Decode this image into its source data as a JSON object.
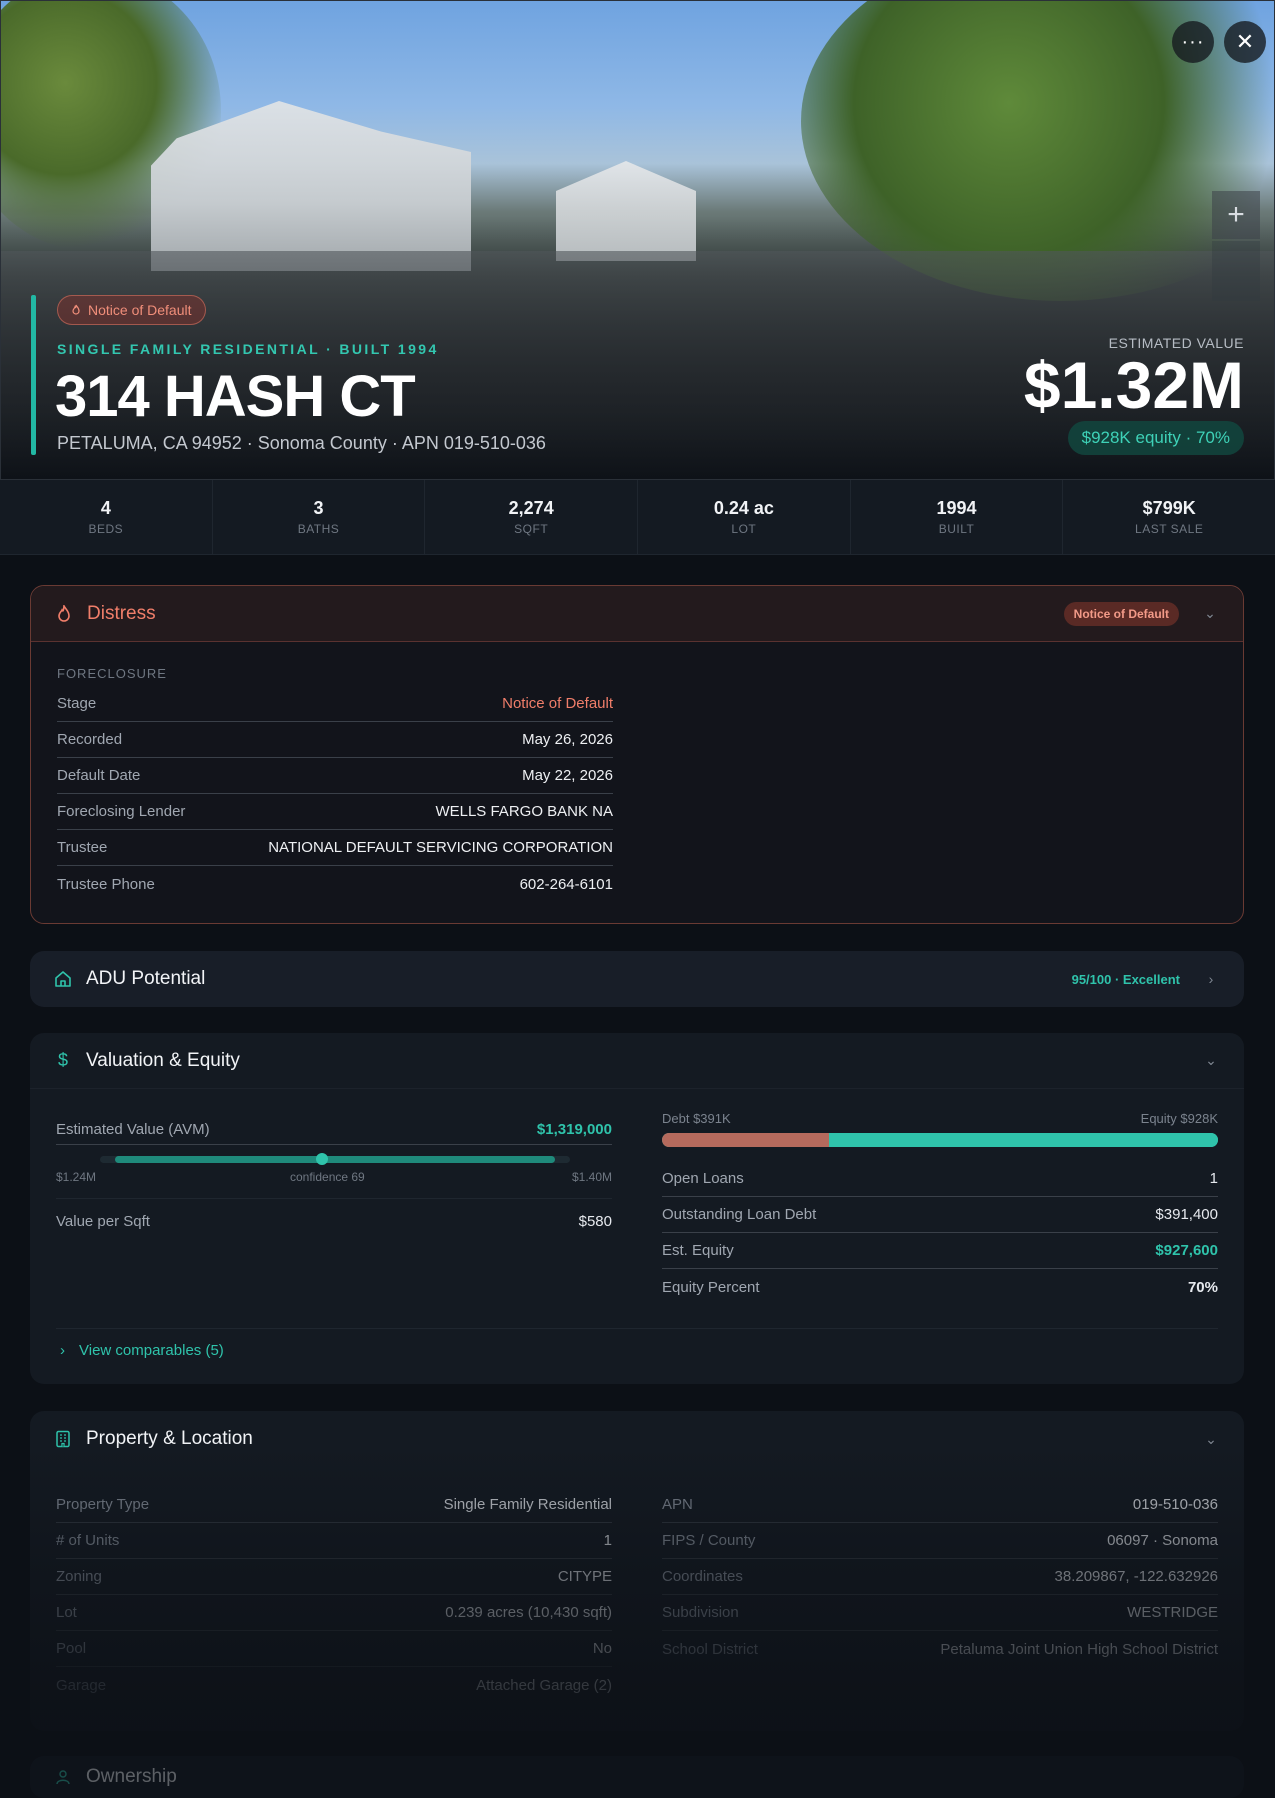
{
  "hero": {
    "badge": "Notice of Default",
    "subtitle": "SINGLE FAMILY RESIDENTIAL · BUILT 1994",
    "title": "314 HASH CT",
    "address": "PETALUMA, CA 94952 · Sonoma County · APN 019-510-036",
    "estimated_label": "ESTIMATED VALUE",
    "estimated_value": "$1.32M",
    "equity_pill": "$928K equity · 70%",
    "more_button": "···",
    "close_button": "✕",
    "zoom_button": "+"
  },
  "stats": [
    {
      "value": "4",
      "label": "BEDS"
    },
    {
      "value": "3",
      "label": "BATHS"
    },
    {
      "value": "2,274",
      "label": "SQFT"
    },
    {
      "value": "0.24 ac",
      "label": "LOT"
    },
    {
      "value": "1994",
      "label": "BUILT"
    },
    {
      "value": "$799K",
      "label": "LAST SALE"
    }
  ],
  "distress": {
    "title": "Distress",
    "badge": "Notice of Default",
    "section": "FORECLOSURE",
    "rows": [
      {
        "key": "Stage",
        "value": "Notice of Default"
      },
      {
        "key": "Recorded",
        "value": "May 26, 2026"
      },
      {
        "key": "Default Date",
        "value": "May 22, 2026"
      },
      {
        "key": "Foreclosing Lender",
        "value": "WELLS FARGO BANK NA"
      },
      {
        "key": "Trustee",
        "value": "NATIONAL DEFAULT SERVICING CORPORATION"
      },
      {
        "key": "Trustee Phone",
        "value": "602-264-6101"
      }
    ]
  },
  "adu": {
    "title": "ADU Potential",
    "score": "95/100 · Excellent"
  },
  "valuation": {
    "title": "Valuation & Equity",
    "avm_label": "Estimated Value (AVM)",
    "avm_value": "$1,319,000",
    "range_low": "$1.24M",
    "range_high": "$1.40M",
    "confidence": "confidence 69",
    "avm_position_pct": 50,
    "value_per_sqft_label": "Value per Sqft",
    "value_per_sqft": "$580",
    "debt_label": "Debt $391K",
    "equity_label": "Equity $928K",
    "debt_fraction": 0.3,
    "rows": [
      {
        "key": "Open Loans",
        "value": "1"
      },
      {
        "key": "Outstanding Loan Debt",
        "value": "$391,400"
      },
      {
        "key": "Est. Equity",
        "value": "$927,600"
      },
      {
        "key": "Equity Percent",
        "value": "70%"
      }
    ],
    "comps_link": "View comparables (5)"
  },
  "property": {
    "title": "Property & Location",
    "left": [
      {
        "key": "Property Type",
        "value": "Single Family Residential"
      },
      {
        "key": "# of Units",
        "value": "1"
      },
      {
        "key": "Zoning",
        "value": "CITYPE"
      },
      {
        "key": "Lot",
        "value": "0.239 acres (10,430 sqft)"
      },
      {
        "key": "Pool",
        "value": "No"
      },
      {
        "key": "Garage",
        "value": "Attached Garage (2)"
      }
    ],
    "right": [
      {
        "key": "APN",
        "value": "019-510-036"
      },
      {
        "key": "FIPS / County",
        "value": "06097 · Sonoma"
      },
      {
        "key": "Coordinates",
        "value": "38.209867, -122.632926"
      },
      {
        "key": "Subdivision",
        "value": "WESTRIDGE"
      },
      {
        "key": "School District",
        "value": "Petaluma Joint Union High School District"
      }
    ]
  },
  "ownership": {
    "title": "Ownership"
  },
  "colors": {
    "accent": "#2fc3ab",
    "distress": "#f07e6a",
    "debt": "#b56a5d"
  }
}
